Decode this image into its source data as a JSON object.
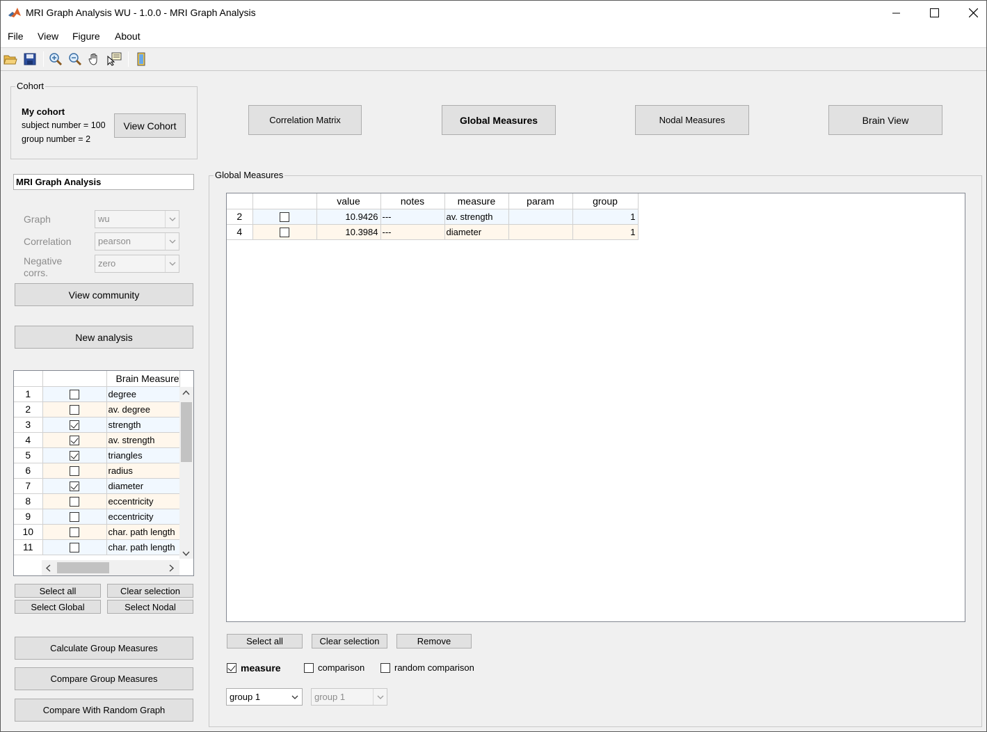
{
  "window": {
    "title": "MRI Graph Analysis WU - 1.0.0 - MRI Graph Analysis"
  },
  "menu": [
    "File",
    "View",
    "Figure",
    "About"
  ],
  "toolbar_icons": [
    "open-folder-icon",
    "save-icon",
    "zoom-in-icon",
    "zoom-out-icon",
    "pan-hand-icon",
    "data-cursor-icon",
    "colorbar-icon"
  ],
  "cohort": {
    "group_title": "Cohort",
    "name": "My cohort",
    "subject_line": "subject number = 100",
    "group_line": "group number = 2",
    "view_button": "View Cohort"
  },
  "nav_buttons": {
    "correlation_matrix": "Correlation Matrix",
    "global_measures": "Global Measures",
    "nodal_measures": "Nodal Measures",
    "brain_view": "Brain View"
  },
  "analysis": {
    "name": "MRI Graph Analysis",
    "graph_label": "Graph",
    "graph_value": "wu",
    "correlation_label": "Correlation",
    "correlation_value": "pearson",
    "negative_label_1": "Negative",
    "negative_label_2": "corrs.",
    "negative_value": "zero",
    "view_community": "View community",
    "new_analysis": "New analysis"
  },
  "brain_measures": {
    "header": "Brain Measure",
    "rows": [
      {
        "n": "1",
        "checked": false,
        "name": "degree"
      },
      {
        "n": "2",
        "checked": false,
        "name": "av. degree"
      },
      {
        "n": "3",
        "checked": true,
        "name": "strength"
      },
      {
        "n": "4",
        "checked": true,
        "name": "av. strength"
      },
      {
        "n": "5",
        "checked": true,
        "name": "triangles"
      },
      {
        "n": "6",
        "checked": false,
        "name": "radius"
      },
      {
        "n": "7",
        "checked": true,
        "name": "diameter"
      },
      {
        "n": "8",
        "checked": false,
        "name": "eccentricity"
      },
      {
        "n": "9",
        "checked": false,
        "name": "eccentricity"
      },
      {
        "n": "10",
        "checked": false,
        "name": "char. path length"
      },
      {
        "n": "11",
        "checked": false,
        "name": "char. path length"
      }
    ]
  },
  "left_buttons": {
    "select_all": "Select all",
    "clear_selection": "Clear selection",
    "select_global": "Select Global",
    "select_nodal": "Select Nodal",
    "calculate": "Calculate Group Measures",
    "compare": "Compare Group Measures",
    "compare_random": "Compare With Random Graph"
  },
  "global_measures": {
    "group_title": "Global Measures",
    "columns": [
      "",
      "value",
      "notes",
      "measure",
      "param",
      "group"
    ],
    "rows": [
      {
        "n": "2",
        "checked": false,
        "value": "10.9426",
        "notes": "---",
        "measure": "av. strength",
        "param": "",
        "group": "1"
      },
      {
        "n": "4",
        "checked": false,
        "value": "10.3984",
        "notes": "---",
        "measure": "diameter",
        "param": "",
        "group": "1"
      }
    ],
    "select_all": "Select all",
    "clear_selection": "Clear selection",
    "remove": "Remove",
    "opt_measure": "measure",
    "opt_measure_checked": true,
    "opt_comparison": "comparison",
    "opt_comparison_checked": false,
    "opt_random": "random comparison",
    "opt_random_checked": false,
    "group_select_1": "group 1",
    "group_select_2": "group 1"
  },
  "colors": {
    "row_blue": "#f1f8ff",
    "row_orange": "#fff7ec",
    "button_face": "#e1e1e1"
  }
}
